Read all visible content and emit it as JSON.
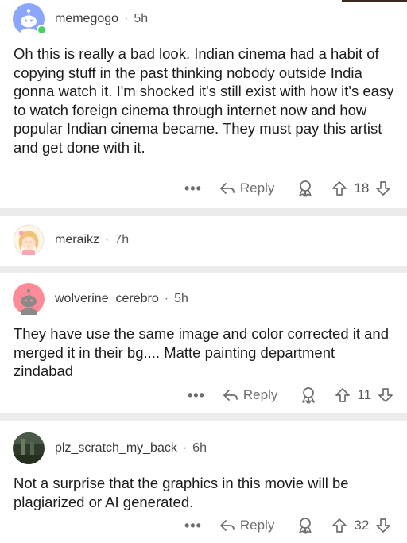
{
  "comments": [
    {
      "username": "memegogo",
      "age": "5h",
      "text": "Oh this is really a bad look. Indian cinema had a habit of copying stuff in the past thinking nobody outside India gonna watch it. I'm shocked it's still exist with how it's easy to watch foreign cinema through internet now and how popular Indian cinema became. They must pay this artist and get done with it.",
      "reply_label": "Reply",
      "votes": "18",
      "more_label": "•••",
      "avatar_color": "#8aa6ff",
      "online": true
    },
    {
      "username": "meraikz",
      "age": "7h",
      "avatar_color": "#f3c37d"
    },
    {
      "username": "wolverine_cerebro",
      "age": "5h",
      "text": "They have use the same image and color corrected it and merged it in their bg.... Matte painting department zindabad",
      "reply_label": "Reply",
      "votes": "11",
      "more_label": "•••",
      "avatar_color": "#ff8b98"
    },
    {
      "username": "plz_scratch_my_back",
      "age": "6h",
      "text": "Not a surprise that the graphics in this movie will be plagiarized or AI generated.",
      "reply_label": "Reply",
      "votes": "32",
      "more_label": "•••",
      "avatar_color": "#3b4a36"
    }
  ],
  "separator": "·"
}
